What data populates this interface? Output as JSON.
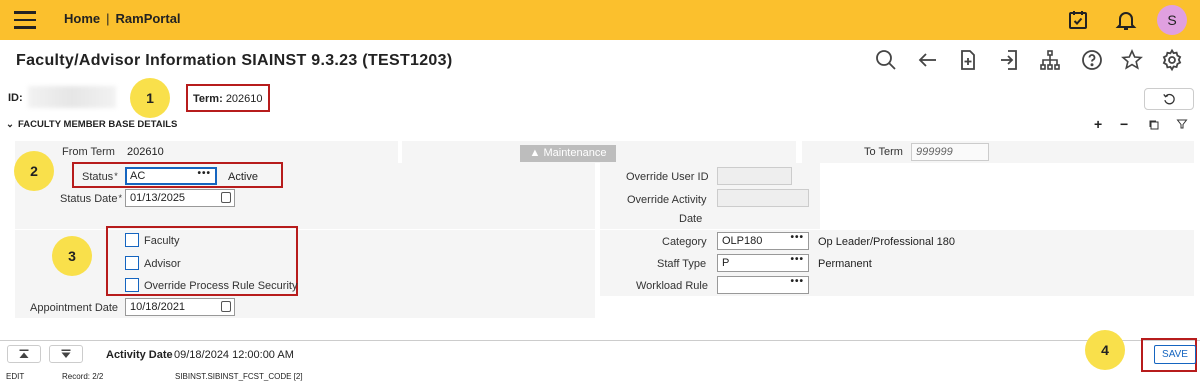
{
  "header": {
    "home": "Home",
    "separator": "|",
    "portal": "RamPortal",
    "avatar_initial": "S"
  },
  "page": {
    "title": "Faculty/Advisor Information SIAINST 9.3.23 (TEST1203)"
  },
  "key_block": {
    "id_label": "ID:",
    "term_label": "Term:",
    "term_value": "202610"
  },
  "markers": [
    "1",
    "2",
    "3",
    "4"
  ],
  "section": {
    "title": "FACULTY MEMBER BASE DETAILS",
    "tools": {
      "add": "+",
      "remove": "−"
    }
  },
  "form": {
    "from_term_label": "From Term",
    "from_term_value": "202610",
    "maintenance_label": "Maintenance",
    "to_term_label": "To Term",
    "to_term_value": "999999",
    "status_label": "Status",
    "status_value": "AC",
    "status_desc": "Active",
    "status_date_label": "Status Date",
    "status_date_value": "01/13/2025",
    "override_user_label": "Override User ID",
    "override_user_value": "",
    "override_activity_label_1": "Override Activity",
    "override_activity_label_2": "Date",
    "override_activity_value": "",
    "faculty_label": "Faculty",
    "advisor_label": "Advisor",
    "override_rule_label": "Override Process Rule Security",
    "category_label": "Category",
    "category_value": "OLP180",
    "category_desc": "Op Leader/Professional 180",
    "staff_type_label": "Staff Type",
    "staff_type_value": "P",
    "staff_type_desc": "Permanent",
    "workload_label": "Workload Rule",
    "workload_value": "",
    "appointment_label": "Appointment Date",
    "appointment_value": "10/18/2021",
    "required_mark": "*",
    "lookup_dots": "•••"
  },
  "footer": {
    "activity_label": "Activity Date",
    "activity_value": "09/18/2024 12:00:00 AM",
    "mode": "EDIT",
    "record": "Record: 2/2",
    "field_path": "SIBINST.SIBINST_FCST_CODE [2]",
    "save_label": "SAVE"
  },
  "icons": [
    "menu-icon",
    "calendar-check-icon",
    "bell-icon",
    "search-icon",
    "back-arrow-icon",
    "new-document-icon",
    "export-icon",
    "hierarchy-icon",
    "help-icon",
    "star-icon",
    "gear-icon",
    "refresh-icon",
    "chevron-down-icon",
    "copy-icon",
    "filter-icon",
    "calendar-icon",
    "first-record-icon",
    "next-record-icon",
    "user-icon"
  ],
  "colors": {
    "topbar": "#fbc02d",
    "accent": "#1565c0",
    "highlight_border": "#b71c1c",
    "marker": "#f9e04b"
  }
}
